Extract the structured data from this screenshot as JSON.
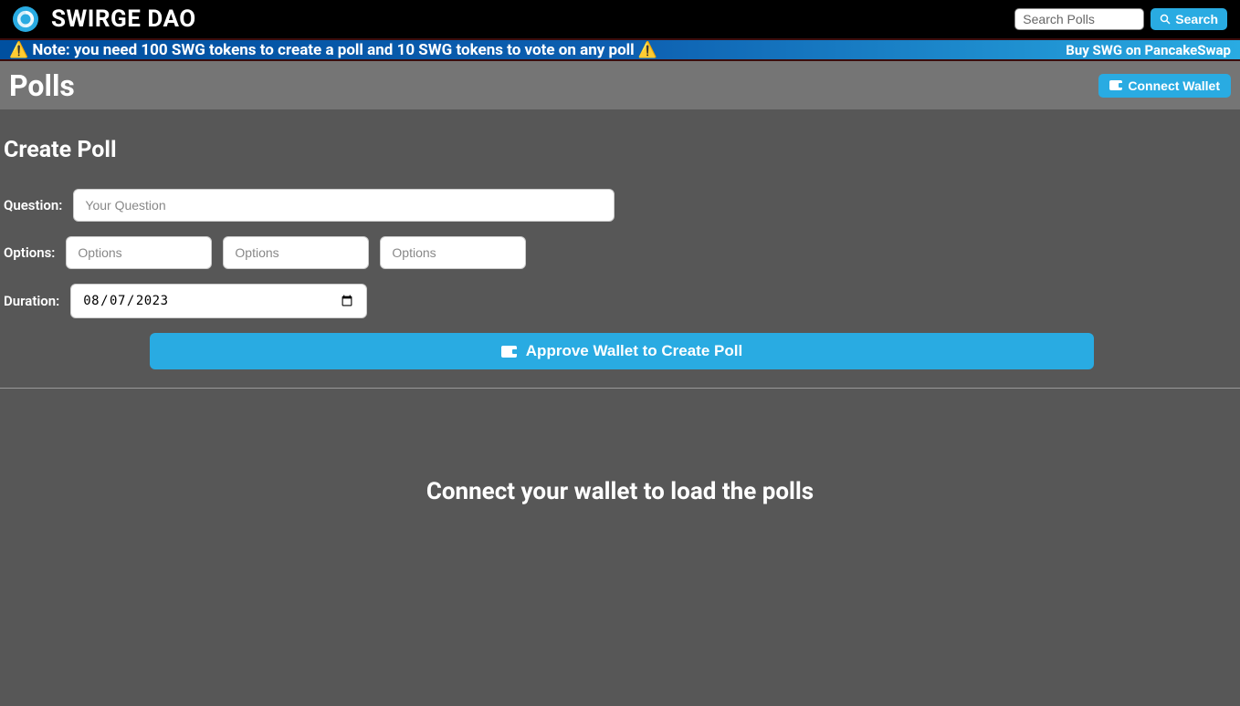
{
  "header": {
    "brand": "SWIRGE DAO",
    "search_placeholder": "Search Polls",
    "search_button": "Search"
  },
  "notice": {
    "text": "⚠️ Note: you need 100 SWG tokens to create a poll and 10 SWG tokens to vote on any poll ⚠️",
    "buy_link": "Buy SWG on PancakeSwap"
  },
  "subheader": {
    "title": "Polls",
    "connect_label": "Connect Wallet"
  },
  "create": {
    "heading": "Create Poll",
    "question_label": "Question:",
    "question_placeholder": "Your Question",
    "options_label": "Options:",
    "option_placeholder_1": "Options",
    "option_placeholder_2": "Options",
    "option_placeholder_3": "Options",
    "duration_label": "Duration:",
    "duration_value": "2023-08-07",
    "approve_label": "Approve Wallet to Create Poll"
  },
  "empty": {
    "message": "Connect your wallet to load the polls"
  }
}
